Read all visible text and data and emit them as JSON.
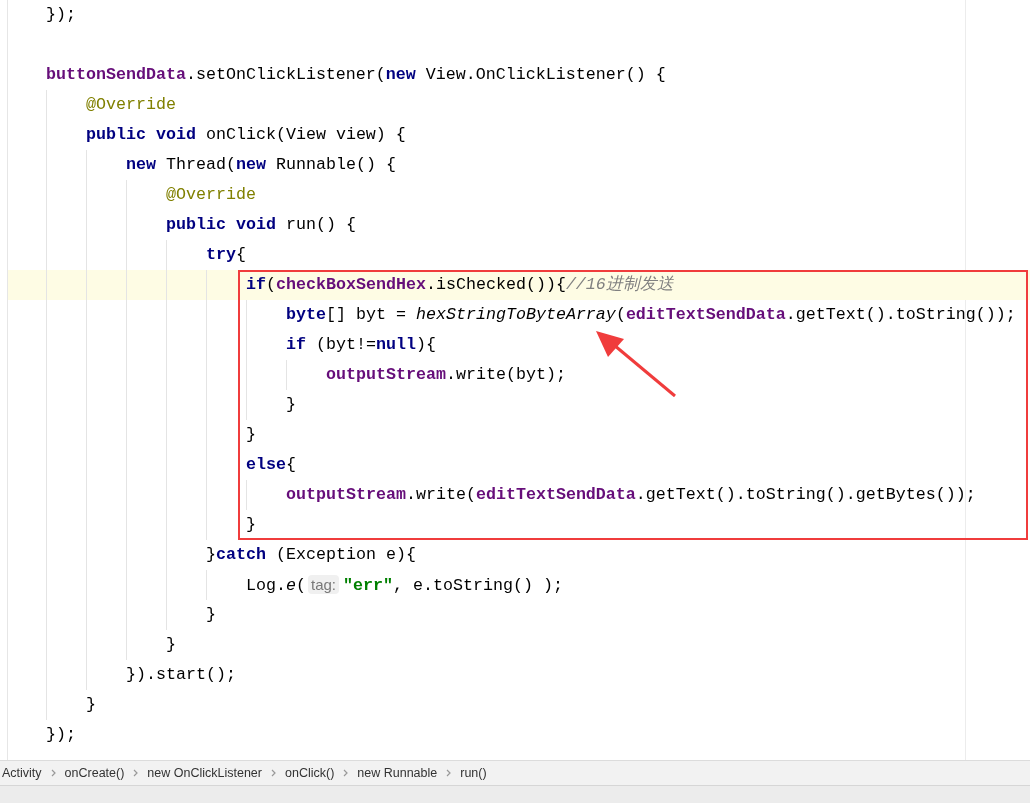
{
  "editor": {
    "lines": [
      {
        "kind": "code",
        "current": false,
        "boxed": false,
        "tokens": [
          {
            "text": "});",
            "kind": "plain"
          }
        ]
      },
      {
        "kind": "blank"
      },
      {
        "kind": "code",
        "current": false,
        "boxed": false,
        "tokens": [
          {
            "text": "buttonSendData",
            "kind": "field"
          },
          {
            "text": ".setOnClickListener(",
            "kind": "plain"
          },
          {
            "text": "new",
            "kind": "keyword"
          },
          {
            "text": " View.OnClickListener() {",
            "kind": "plain"
          }
        ],
        "children": [
          {
            "current": false,
            "boxed": false,
            "tokens": [
              {
                "text": "@Override",
                "kind": "annotation"
              }
            ]
          },
          {
            "current": false,
            "boxed": false,
            "tokens": [
              {
                "text": "public void",
                "kind": "keyword"
              },
              {
                "text": " onClick(View view) {",
                "kind": "plain"
              }
            ],
            "children": [
              {
                "current": false,
                "boxed": false,
                "tokens": [
                  {
                    "text": "new",
                    "kind": "keyword"
                  },
                  {
                    "text": " Thread(",
                    "kind": "plain"
                  },
                  {
                    "text": "new",
                    "kind": "keyword"
                  },
                  {
                    "text": " Runnable() {",
                    "kind": "plain"
                  }
                ],
                "children": [
                  {
                    "current": false,
                    "boxed": false,
                    "tokens": [
                      {
                        "text": "@Override",
                        "kind": "annotation"
                      }
                    ]
                  },
                  {
                    "current": false,
                    "boxed": false,
                    "tokens": [
                      {
                        "text": "public void",
                        "kind": "keyword"
                      },
                      {
                        "text": " run() {",
                        "kind": "plain"
                      }
                    ],
                    "children": [
                      {
                        "current": false,
                        "boxed": false,
                        "tokens": [
                          {
                            "text": "try",
                            "kind": "keyword"
                          },
                          {
                            "text": "{",
                            "kind": "plain"
                          }
                        ],
                        "children": [
                          {
                            "current": true,
                            "boxed": true,
                            "tokens": [
                              {
                                "text": "if",
                                "kind": "keyword"
                              },
                              {
                                "text": "(",
                                "kind": "plain"
                              },
                              {
                                "text": "checkBoxSendHex",
                                "kind": "field"
                              },
                              {
                                "text": ".isChecked()){",
                                "kind": "plain"
                              },
                              {
                                "text": "//16进制发送",
                                "kind": "comment"
                              }
                            ],
                            "children": [
                              {
                                "current": false,
                                "boxed": true,
                                "tokens": [
                                  {
                                    "text": "byte",
                                    "kind": "keyword"
                                  },
                                  {
                                    "text": "[] byt = ",
                                    "kind": "plain"
                                  },
                                  {
                                    "text": "hexStringToByteArray",
                                    "kind": "static"
                                  },
                                  {
                                    "text": "(",
                                    "kind": "plain"
                                  },
                                  {
                                    "text": "editTextSendData",
                                    "kind": "field"
                                  },
                                  {
                                    "text": ".getText().toString());",
                                    "kind": "plain"
                                  }
                                ]
                              },
                              {
                                "current": false,
                                "boxed": true,
                                "tokens": [
                                  {
                                    "text": "if",
                                    "kind": "keyword"
                                  },
                                  {
                                    "text": " (byt!=",
                                    "kind": "plain"
                                  },
                                  {
                                    "text": "null",
                                    "kind": "keyword"
                                  },
                                  {
                                    "text": "){",
                                    "kind": "plain"
                                  }
                                ],
                                "children": [
                                  {
                                    "current": false,
                                    "boxed": true,
                                    "tokens": [
                                      {
                                        "text": "outputStream",
                                        "kind": "field"
                                      },
                                      {
                                        "text": ".write(byt);",
                                        "kind": "plain"
                                      }
                                    ]
                                  }
                                ]
                              },
                              {
                                "current": false,
                                "boxed": true,
                                "tokens": [
                                  {
                                    "text": "}",
                                    "kind": "plain"
                                  }
                                ]
                              }
                            ]
                          },
                          {
                            "current": false,
                            "boxed": true,
                            "tokens": [
                              {
                                "text": "}",
                                "kind": "plain"
                              }
                            ]
                          },
                          {
                            "current": false,
                            "boxed": true,
                            "tokens": [
                              {
                                "text": "else",
                                "kind": "keyword"
                              },
                              {
                                "text": "{",
                                "kind": "plain"
                              }
                            ],
                            "children": [
                              {
                                "current": false,
                                "boxed": true,
                                "tokens": [
                                  {
                                    "text": "outputStream",
                                    "kind": "field"
                                  },
                                  {
                                    "text": ".write(",
                                    "kind": "plain"
                                  },
                                  {
                                    "text": "editTextSendData",
                                    "kind": "field"
                                  },
                                  {
                                    "text": ".getText().toString().getBytes());",
                                    "kind": "plain"
                                  }
                                ]
                              }
                            ]
                          },
                          {
                            "current": false,
                            "boxed": true,
                            "tokens": [
                              {
                                "text": "}",
                                "kind": "plain"
                              }
                            ]
                          }
                        ]
                      },
                      {
                        "current": false,
                        "boxed": false,
                        "tokens": [
                          {
                            "text": "}",
                            "kind": "plain"
                          },
                          {
                            "text": "catch",
                            "kind": "keyword"
                          },
                          {
                            "text": " (Exception e){",
                            "kind": "plain"
                          }
                        ],
                        "children": [
                          {
                            "current": false,
                            "boxed": false,
                            "tokens": [
                              {
                                "text": "Log.",
                                "kind": "plain"
                              },
                              {
                                "text": "e",
                                "kind": "static"
                              },
                              {
                                "text": "(",
                                "kind": "plain"
                              },
                              {
                                "text": "tag:",
                                "kind": "hint"
                              },
                              {
                                "text": "\"err\"",
                                "kind": "string"
                              },
                              {
                                "text": ", e.toString() );",
                                "kind": "plain"
                              }
                            ]
                          }
                        ]
                      },
                      {
                        "current": false,
                        "boxed": false,
                        "tokens": [
                          {
                            "text": "}",
                            "kind": "plain"
                          }
                        ]
                      }
                    ]
                  },
                  {
                    "current": false,
                    "boxed": false,
                    "tokens": [
                      {
                        "text": "}",
                        "kind": "plain"
                      }
                    ]
                  }
                ]
              },
              {
                "current": false,
                "boxed": false,
                "tokens": [
                  {
                    "text": "}).start();",
                    "kind": "plain"
                  }
                ]
              }
            ]
          },
          {
            "current": false,
            "boxed": false,
            "tokens": [
              {
                "text": "}",
                "kind": "plain"
              }
            ]
          }
        ]
      },
      {
        "kind": "code",
        "current": false,
        "boxed": false,
        "tokens": [
          {
            "text": "});",
            "kind": "plain"
          }
        ]
      }
    ]
  },
  "breadcrumbs": [
    "Activity",
    "onCreate()",
    "new OnClickListener",
    "onClick()",
    "new Runnable",
    "run()"
  ]
}
